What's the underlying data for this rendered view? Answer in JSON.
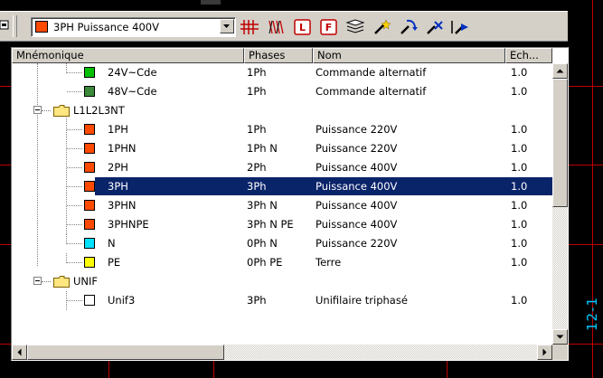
{
  "toolbar": {
    "combo": {
      "label": "3PH Puissance 400V",
      "swatch_color": "#ff4a00"
    },
    "buttons": [
      {
        "icon": "multi-wire-icon"
      },
      {
        "icon": "wire-bundle-icon"
      },
      {
        "icon": "l-box-icon",
        "glyph": "L"
      },
      {
        "icon": "f-box-icon",
        "glyph": "F"
      },
      {
        "icon": "stack-list-icon"
      },
      {
        "icon": "magic-wand-icon"
      },
      {
        "icon": "wand-arrow-icon"
      },
      {
        "icon": "wand-remove-icon"
      },
      {
        "icon": "wand-select-icon"
      }
    ]
  },
  "tree": {
    "columns": [
      "Mnémonique",
      "Phases",
      "Nom",
      "Ech..."
    ],
    "rows": [
      {
        "mnemo": "24V~Cde",
        "phases": "1Ph",
        "nom": "Commande alternatif",
        "ech": "1.0",
        "color": "#00c000"
      },
      {
        "mnemo": "48V~Cde",
        "phases": "1Ph",
        "nom": "Commande alternatif",
        "ech": "1.0",
        "color": "#3a8a3a"
      },
      {
        "mnemo": "L1L2L3NT",
        "folder": true
      },
      {
        "mnemo": "1PH",
        "phases": "1Ph",
        "nom": "Puissance 220V",
        "ech": "1.0",
        "color": "#ff4a00"
      },
      {
        "mnemo": "1PHN",
        "phases": "1Ph N",
        "nom": "Puissance 220V",
        "ech": "1.0",
        "color": "#ff4a00"
      },
      {
        "mnemo": "2PH",
        "phases": "2Ph",
        "nom": "Puissance 400V",
        "ech": "1.0",
        "color": "#ff4a00"
      },
      {
        "mnemo": "3PH",
        "phases": "3Ph",
        "nom": "Puissance 400V",
        "ech": "1.0",
        "color": "#ff4a00",
        "selected": true
      },
      {
        "mnemo": "3PHN",
        "phases": "3Ph N",
        "nom": "Puissance 400V",
        "ech": "1.0",
        "color": "#ff4a00"
      },
      {
        "mnemo": "3PHNPE",
        "phases": "3Ph N PE",
        "nom": "Puissance 400V",
        "ech": "1.0",
        "color": "#ff4a00"
      },
      {
        "mnemo": "N",
        "phases": "0Ph N",
        "nom": "Puissance 220V",
        "ech": "1.0",
        "color": "#00e0ff"
      },
      {
        "mnemo": "PE",
        "phases": "0Ph PE",
        "nom": "Terre",
        "ech": "1.0",
        "color": "#ffff00"
      },
      {
        "mnemo": "UNIF",
        "folder": true
      },
      {
        "mnemo": "Unif3",
        "phases": "3Ph",
        "nom": "Unifilaire triphasé",
        "ech": "1.0",
        "color": "#ffffff"
      }
    ]
  },
  "side_label": "12-1"
}
